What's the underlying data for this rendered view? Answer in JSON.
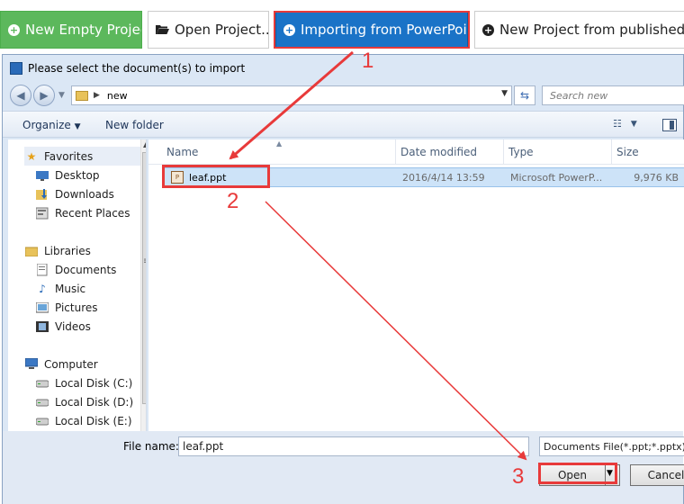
{
  "toolbar": {
    "new_empty": "New Empty Project",
    "open_project": "Open Project...",
    "import_ppt": "Importing from PowerPoint",
    "new_from_published": "New Project from published file"
  },
  "dialog": {
    "title": "Please select the document(s) to import",
    "address": {
      "path": "new"
    },
    "search_placeholder": "Search new",
    "commands": {
      "organize": "Organize",
      "new_folder": "New folder"
    },
    "nav": {
      "favorites": "Favorites",
      "favorites_items": [
        "Desktop",
        "Downloads",
        "Recent Places"
      ],
      "libraries": "Libraries",
      "libraries_items": [
        "Documents",
        "Music",
        "Pictures",
        "Videos"
      ],
      "computer": "Computer",
      "computer_items": [
        "Local Disk (C:)",
        "Local Disk (D:)",
        "Local Disk (E:)"
      ]
    },
    "columns": {
      "name": "Name",
      "date": "Date modified",
      "type": "Type",
      "size": "Size"
    },
    "files": [
      {
        "name": "leaf.ppt",
        "date": "2016/4/14 13:59",
        "type": "Microsoft PowerP...",
        "size": "9,976 KB"
      }
    ],
    "file_name_label": "File name:",
    "file_name_value": "leaf.ppt",
    "file_type": "Documents File(*.ppt;*.pptx)",
    "open_label": "Open",
    "cancel_label": "Cancel"
  },
  "annotations": {
    "step1": "1",
    "step2": "2",
    "step3": "3",
    "color": "#e83a3a"
  },
  "colors": {
    "green": "#5cb85c",
    "blue": "#1a73c7",
    "selection": "#cde3f8"
  }
}
